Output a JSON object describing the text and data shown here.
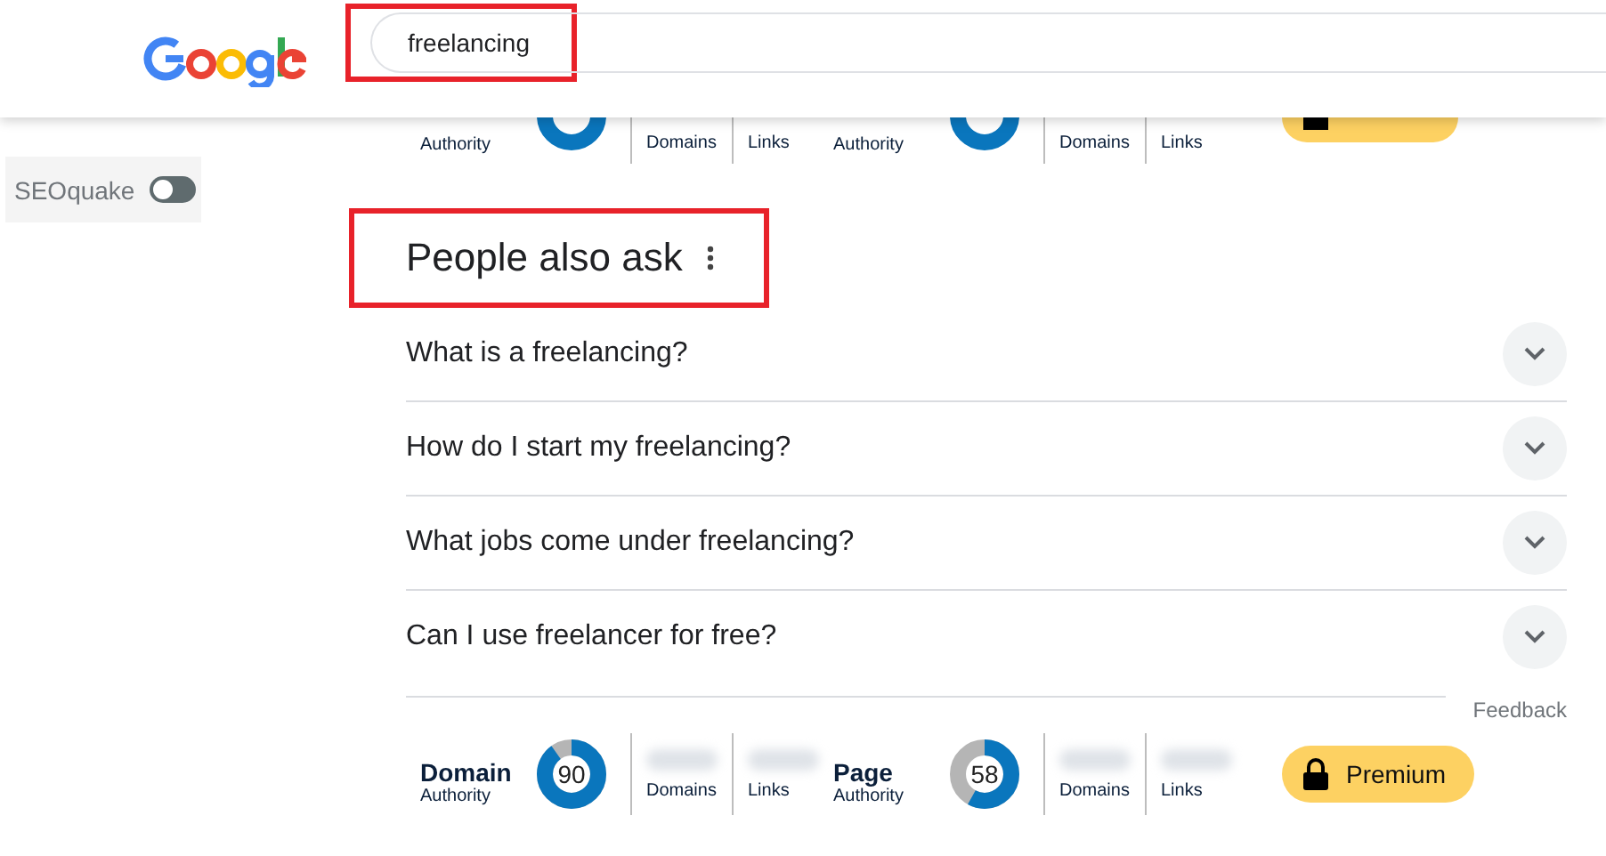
{
  "header": {
    "search": {
      "value": "freelancing",
      "highlighted": true
    }
  },
  "top_metrics": {
    "groups": [
      {
        "subtitle": "Authority",
        "columns": [
          "Domains",
          "Links"
        ]
      },
      {
        "subtitle": "Authority",
        "columns": [
          "Domains",
          "Links"
        ]
      }
    ]
  },
  "sidebar": {
    "toggle": {
      "label": "SEOquake",
      "on": false
    }
  },
  "people_also_ask": {
    "title": "People also ask",
    "highlighted": true,
    "questions": [
      {
        "text": "What is a freelancing?",
        "expanded": false
      },
      {
        "text": "How do I start my freelancing?",
        "expanded": false
      },
      {
        "text": "What jobs come under freelancing?",
        "expanded": false
      },
      {
        "text": "Can I use freelancer for free?",
        "expanded": false
      }
    ],
    "feedback": "Feedback"
  },
  "bottom_metrics": {
    "groups": [
      {
        "title": "Domain",
        "subtitle": "Authority",
        "value": "90",
        "level": 0.9,
        "columns": [
          "Domains",
          "Links"
        ]
      },
      {
        "title": "Page",
        "subtitle": "Authority",
        "value": "58",
        "level": 0.58,
        "columns": [
          "Domains",
          "Links"
        ]
      }
    ],
    "premium_label": "Premium"
  }
}
